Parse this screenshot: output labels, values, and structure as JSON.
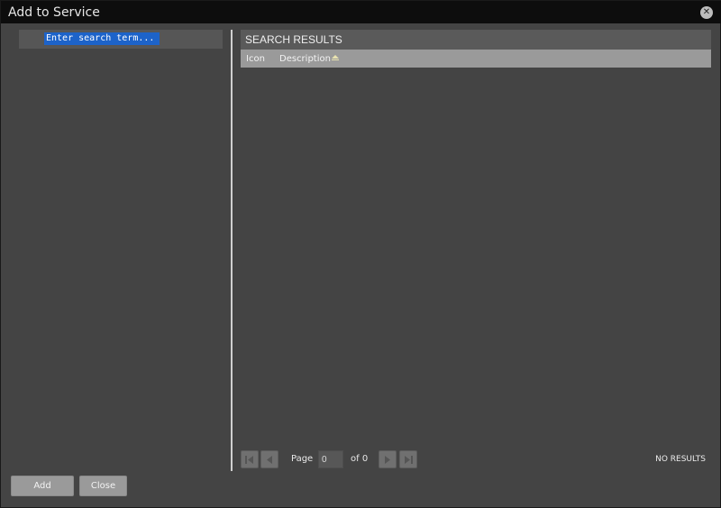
{
  "window": {
    "title": "Add to Service"
  },
  "search": {
    "placeholder": "Enter search term..."
  },
  "results": {
    "title": "SEARCH RESULTS",
    "columns": {
      "icon": "Icon",
      "description": "Description"
    },
    "rows": []
  },
  "pager": {
    "page_label": "Page",
    "page_value": "0",
    "of_label": "of 0",
    "status": "NO RESULTS"
  },
  "footer": {
    "add_label": "Add",
    "close_label": "Close"
  },
  "colors": {
    "panel": "#444444",
    "titlebar": "#0d0d0d",
    "search_highlight": "#1d63c9",
    "column_header": "#9a9a9a"
  }
}
